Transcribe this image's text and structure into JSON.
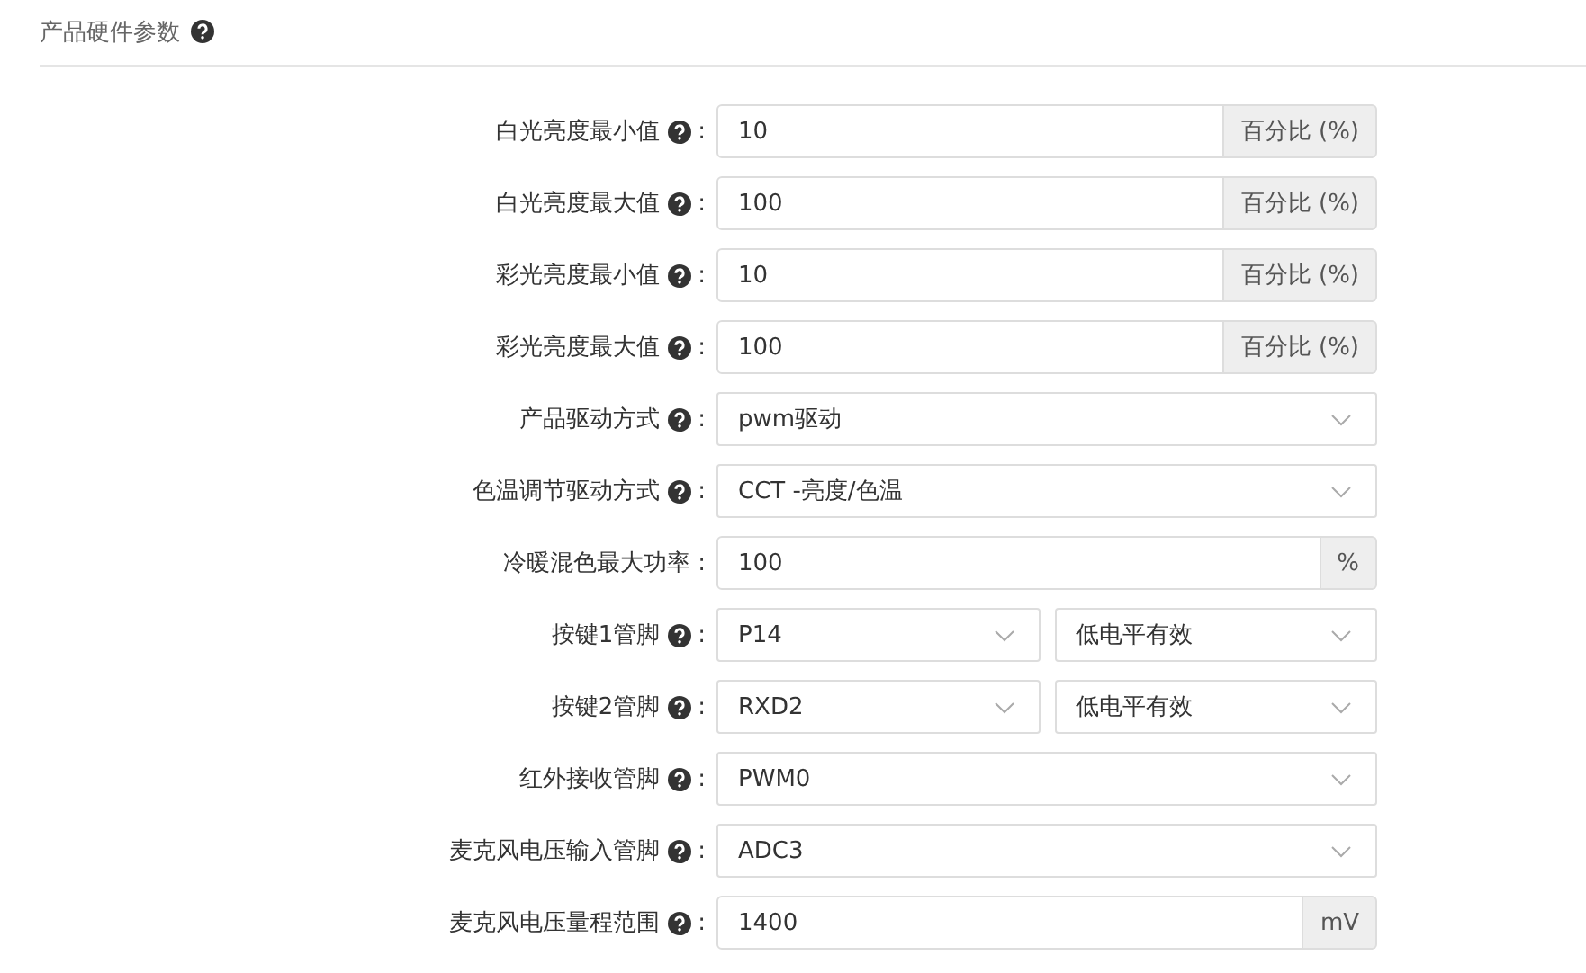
{
  "section": {
    "title": "产品硬件参数",
    "help": true
  },
  "rows": [
    {
      "label": "白光亮度最小值",
      "help": true,
      "colon": ":",
      "kind": "input",
      "value": "10",
      "addon": "百分比 (%)"
    },
    {
      "label": "白光亮度最大值",
      "help": true,
      "colon": ":",
      "kind": "input",
      "value": "100",
      "addon": "百分比 (%)"
    },
    {
      "label": "彩光亮度最小值",
      "help": true,
      "colon": ":",
      "kind": "input",
      "value": "10",
      "addon": "百分比 (%)"
    },
    {
      "label": "彩光亮度最大值",
      "help": true,
      "colon": ":",
      "kind": "input",
      "value": "100",
      "addon": "百分比 (%)"
    },
    {
      "label": "产品驱动方式",
      "help": true,
      "colon": ":",
      "kind": "select",
      "value": "pwm驱动"
    },
    {
      "label": "色温调节驱动方式",
      "help": true,
      "colon": ":",
      "kind": "select",
      "value": "CCT -亮度/色温"
    },
    {
      "label": "冷暖混色最大功率",
      "help": false,
      "colon": ":",
      "kind": "input",
      "value": "100",
      "addon": "%"
    },
    {
      "label": "按键1管脚",
      "help": true,
      "colon": ":",
      "kind": "select-pair",
      "value": "P14",
      "value2": "低电平有效"
    },
    {
      "label": "按键2管脚",
      "help": true,
      "colon": ":",
      "kind": "select-pair",
      "value": "RXD2",
      "value2": "低电平有效"
    },
    {
      "label": "红外接收管脚",
      "help": true,
      "colon": ":",
      "kind": "select",
      "value": "PWM0"
    },
    {
      "label": "麦克风电压输入管脚",
      "help": true,
      "colon": ":",
      "kind": "select",
      "value": "ADC3"
    },
    {
      "label": "麦克风电压量程范围",
      "help": true,
      "colon": ":",
      "kind": "input",
      "value": "1400",
      "addon": "mV"
    }
  ]
}
